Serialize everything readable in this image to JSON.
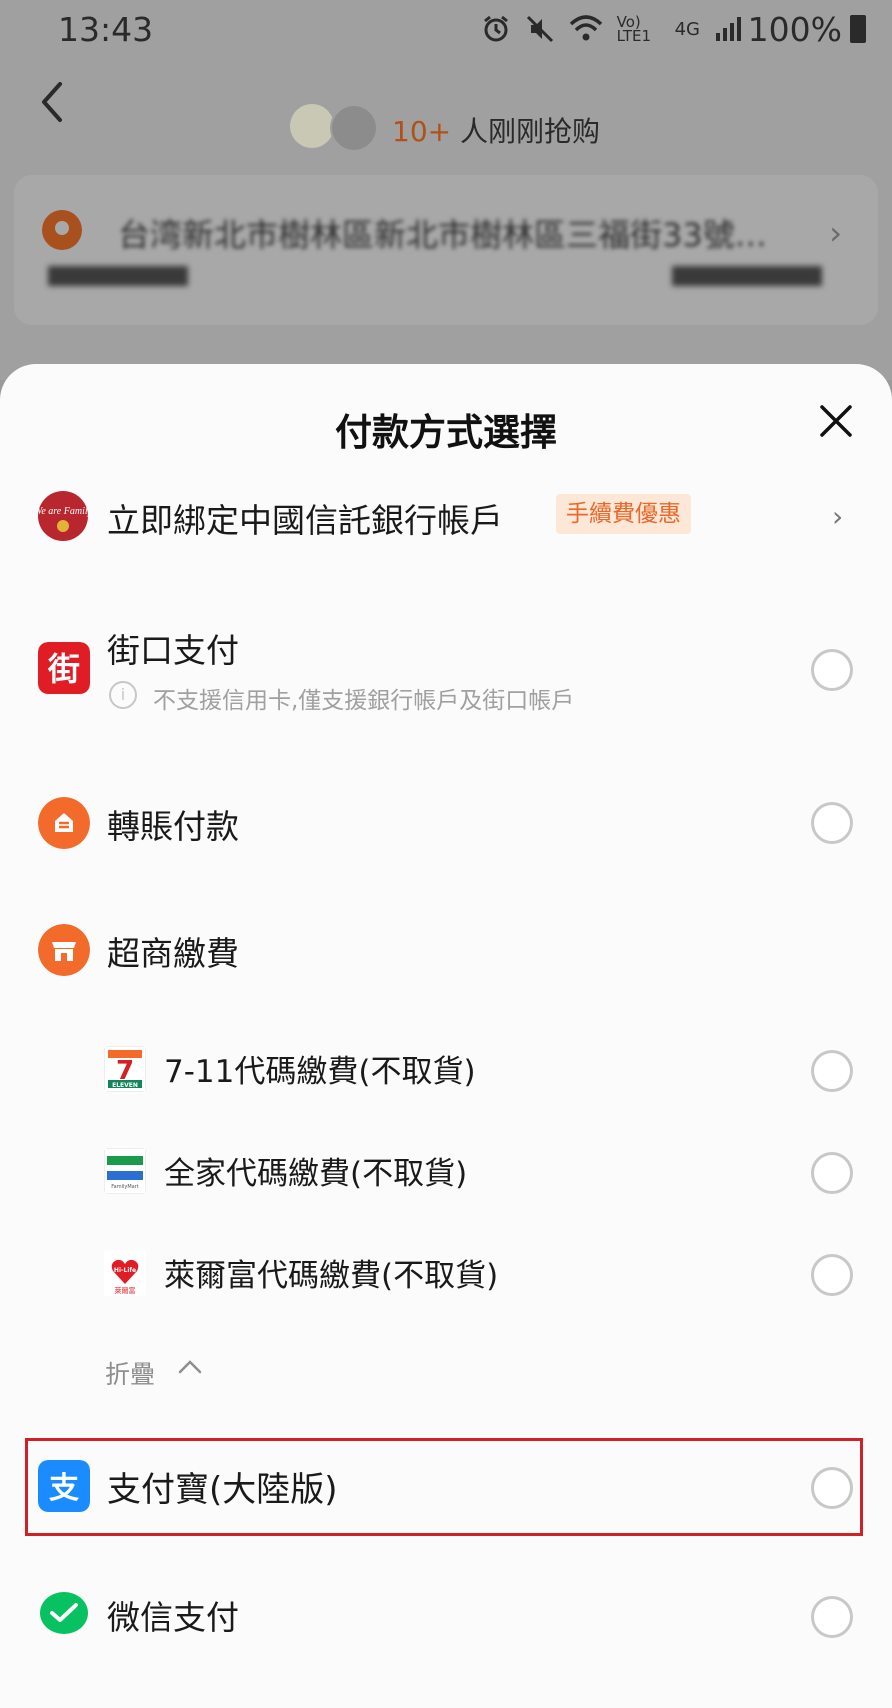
{
  "status_bar": {
    "time": "13:43",
    "net_volte": "Vo) LTE1",
    "net_type": "4G",
    "battery": "100%"
  },
  "product": {
    "buyers_count": "10+",
    "buyers_suffix": " 人刚刚抢购"
  },
  "address": {
    "text": "台湾新北市樹林區新北市樹林區三福街33號…"
  },
  "sheet": {
    "title": "付款方式選擇",
    "bind_bank": {
      "label": "立即綁定中國信託銀行帳戶",
      "badge": "手續費優惠"
    },
    "methods": [
      {
        "id": "jkopay",
        "label": "街口支付",
        "hint": "不支援信用卡,僅支援銀行帳戶及街口帳戶"
      },
      {
        "id": "transfer",
        "label": "轉賬付款"
      },
      {
        "id": "cvs",
        "label": "超商繳費"
      },
      {
        "id": "seven",
        "label": "7-11代碼繳費(不取貨)"
      },
      {
        "id": "family",
        "label": "全家代碼繳費(不取貨)"
      },
      {
        "id": "hilife",
        "label": "萊爾富代碼繳費(不取貨)"
      },
      {
        "id": "alipay",
        "label": "支付寶(大陸版)"
      },
      {
        "id": "wechat",
        "label": "微信支付"
      }
    ],
    "collapse_label": "折疊",
    "icon_texts": {
      "jkopay": "街",
      "seven": "7",
      "seven_sub": "ELEVEN",
      "family_sub": "FamilyMart",
      "hilife_top": "Hi-Life",
      "hilife_sub": "萊爾富",
      "bank_logo": "We are Family",
      "alipay": "支"
    }
  },
  "colors": {
    "accent": "#e8692b",
    "highlight": "#d31f26",
    "jkopay": "#e01d25",
    "alipay": "#1a8cff",
    "wechat": "#08c160",
    "orange_icon": "#f26b2b"
  }
}
